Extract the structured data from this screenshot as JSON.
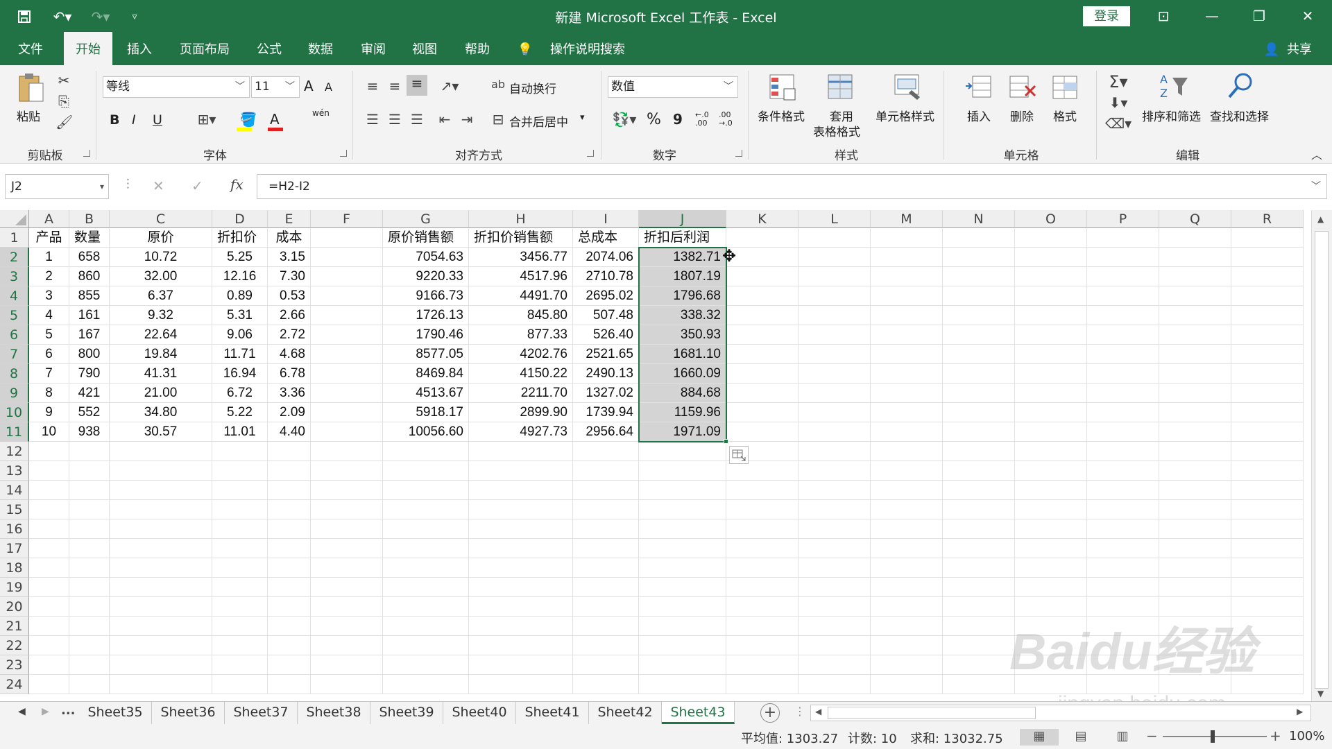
{
  "window": {
    "title": "新建 Microsoft Excel 工作表  -  Excel",
    "login": "登录"
  },
  "ribbon_tabs": [
    "文件",
    "开始",
    "插入",
    "页面布局",
    "公式",
    "数据",
    "审阅",
    "视图",
    "帮助"
  ],
  "tell_me": "操作说明搜索",
  "share": "共享",
  "ribbon": {
    "clipboard": {
      "paste": "粘贴",
      "label": "剪贴板"
    },
    "font": {
      "name": "等线",
      "size": "11",
      "bold": "B",
      "italic": "I",
      "underline": "U",
      "label": "字体",
      "grow": "A",
      "shrink": "A",
      "wen": "wén"
    },
    "alignment": {
      "wrap": "自动换行",
      "merge": "合并后居中",
      "label": "对齐方式"
    },
    "number": {
      "format": "数值",
      "percent": "%",
      "comma": "9",
      "label": "数字",
      "inc": "←.0 .00",
      "dec": ".00 →.0"
    },
    "styles": {
      "conditional": "条件格式",
      "table1": "套用",
      "table2": "表格格式",
      "cell_styles": "单元格样式",
      "label": "样式"
    },
    "cells": {
      "insert": "插入",
      "delete": "删除",
      "format": "格式",
      "label": "单元格"
    },
    "editing": {
      "sort": "排序和筛选",
      "find": "查找和选择",
      "label": "编辑"
    }
  },
  "formula_bar": {
    "name_box": "J2",
    "formula": "=H2-I2",
    "fx": "fx"
  },
  "columns": [
    "A",
    "B",
    "C",
    "D",
    "E",
    "F",
    "G",
    "H",
    "I",
    "J",
    "K",
    "L",
    "M",
    "N",
    "O",
    "P",
    "Q",
    "R"
  ],
  "selected_column": "J",
  "rows": [
    "1",
    "2",
    "3",
    "4",
    "5",
    "6",
    "7",
    "8",
    "9",
    "10",
    "11",
    "12",
    "13",
    "14",
    "15",
    "16",
    "17",
    "18",
    "19",
    "20",
    "21",
    "22",
    "23",
    "24"
  ],
  "headers": {
    "A": "产品",
    "B": "数量",
    "C": "原价",
    "D": "折扣价",
    "E": "成本",
    "G": "原价销售额",
    "H": "折扣价销售额",
    "I": "总成本",
    "J": "折扣后利润"
  },
  "table": [
    [
      "1",
      "658",
      "10.72",
      "5.25",
      "3.15",
      "7054.63",
      "3456.77",
      "2074.06",
      "1382.71"
    ],
    [
      "2",
      "860",
      "32.00",
      "12.16",
      "7.30",
      "9220.33",
      "4517.96",
      "2710.78",
      "1807.19"
    ],
    [
      "3",
      "855",
      "6.37",
      "0.89",
      "0.53",
      "9166.73",
      "4491.70",
      "2695.02",
      "1796.68"
    ],
    [
      "4",
      "161",
      "9.32",
      "5.31",
      "2.66",
      "1726.13",
      "845.80",
      "507.48",
      "338.32"
    ],
    [
      "5",
      "167",
      "22.64",
      "9.06",
      "2.72",
      "1790.46",
      "877.33",
      "526.40",
      "350.93"
    ],
    [
      "6",
      "800",
      "19.84",
      "11.71",
      "4.68",
      "8577.05",
      "4202.76",
      "2521.65",
      "1681.10"
    ],
    [
      "7",
      "790",
      "41.31",
      "16.94",
      "6.78",
      "8469.84",
      "4150.22",
      "2490.13",
      "1660.09"
    ],
    [
      "8",
      "421",
      "21.00",
      "6.72",
      "3.36",
      "4513.67",
      "2211.70",
      "1327.02",
      "884.68"
    ],
    [
      "9",
      "552",
      "34.80",
      "5.22",
      "2.09",
      "5918.17",
      "2899.90",
      "1739.94",
      "1159.96"
    ],
    [
      "10",
      "938",
      "30.57",
      "11.01",
      "4.40",
      "10056.60",
      "4927.73",
      "2956.64",
      "1971.09"
    ]
  ],
  "sheets": [
    "Sheet35",
    "Sheet36",
    "Sheet37",
    "Sheet38",
    "Sheet39",
    "Sheet40",
    "Sheet41",
    "Sheet42",
    "Sheet43"
  ],
  "active_sheet": "Sheet43",
  "sheet_nav": {
    "more": "..."
  },
  "status": {
    "average": "平均值: 1303.27",
    "count": "计数: 10",
    "sum": "求和: 13032.75",
    "zoom": "100%"
  },
  "watermark": {
    "main": "Baidu经验",
    "sub": "jingyan.baidu.com"
  },
  "colors": {
    "accent": "#217346",
    "selection": "#d4d4d4"
  }
}
